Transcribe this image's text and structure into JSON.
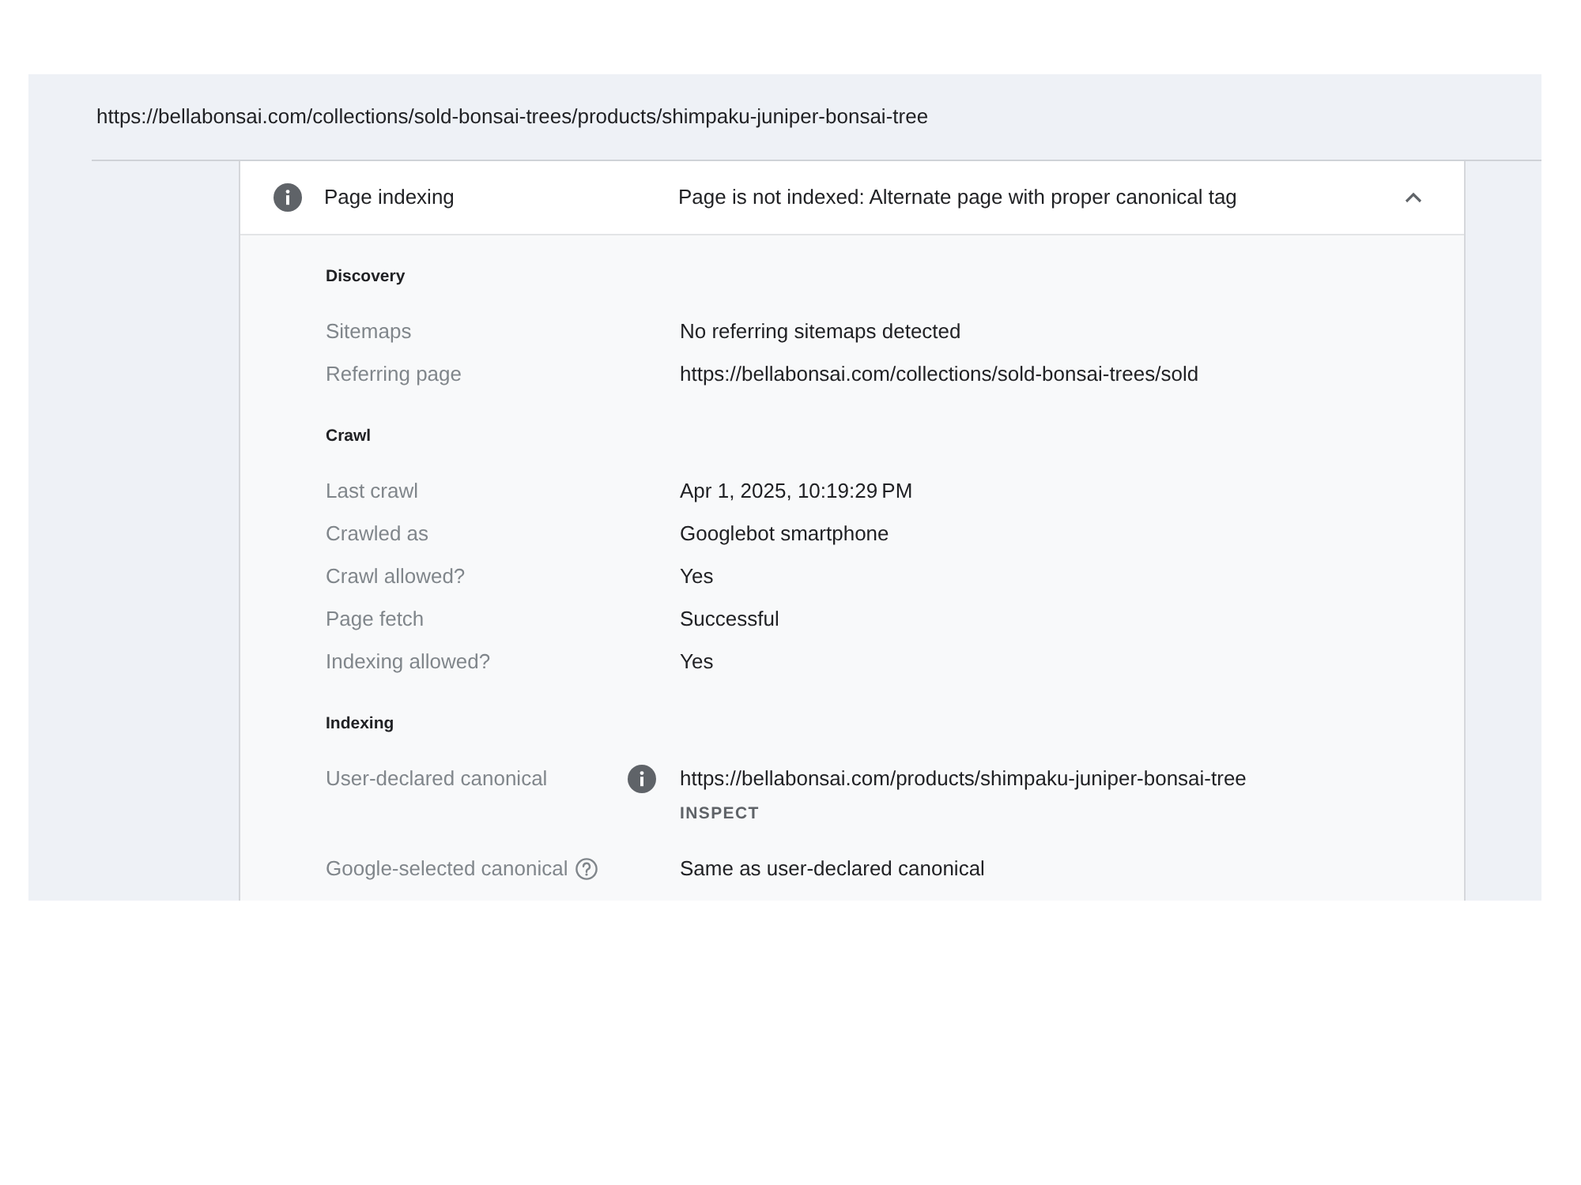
{
  "inspected_url": "https://bellabonsai.com/collections/sold-bonsai-trees/products/shimpaku-juniper-bonsai-tree",
  "panel": {
    "title": "Page indexing",
    "status": "Page is not indexed: Alternate page with proper canonical tag",
    "expanded": true
  },
  "sections": [
    {
      "heading": "Discovery",
      "rows": [
        {
          "kind": "plain",
          "label": "Sitemaps",
          "value": "No referring sitemaps detected"
        },
        {
          "kind": "plain",
          "label": "Referring page",
          "value": "https://bellabonsai.com/collections/sold-bonsai-trees/sold"
        }
      ]
    },
    {
      "heading": "Crawl",
      "rows": [
        {
          "kind": "plain",
          "label": "Last crawl",
          "value": "Apr 1, 2025, 10:19:29 PM"
        },
        {
          "kind": "plain",
          "label": "Crawled as",
          "value": "Googlebot smartphone"
        },
        {
          "kind": "plain",
          "label": "Crawl allowed?",
          "value": "Yes"
        },
        {
          "kind": "plain",
          "label": "Page fetch",
          "value": "Successful"
        },
        {
          "kind": "plain",
          "label": "Indexing allowed?",
          "value": "Yes"
        }
      ]
    },
    {
      "heading": "Indexing",
      "rows": [
        {
          "kind": "info",
          "label": "User-declared canonical",
          "value": "https://bellabonsai.com/products/shimpaku-juniper-bonsai-tree",
          "action": "INSPECT"
        },
        {
          "kind": "help",
          "label": "Google-selected canonical",
          "value": "Same as user-declared canonical"
        }
      ]
    }
  ]
}
